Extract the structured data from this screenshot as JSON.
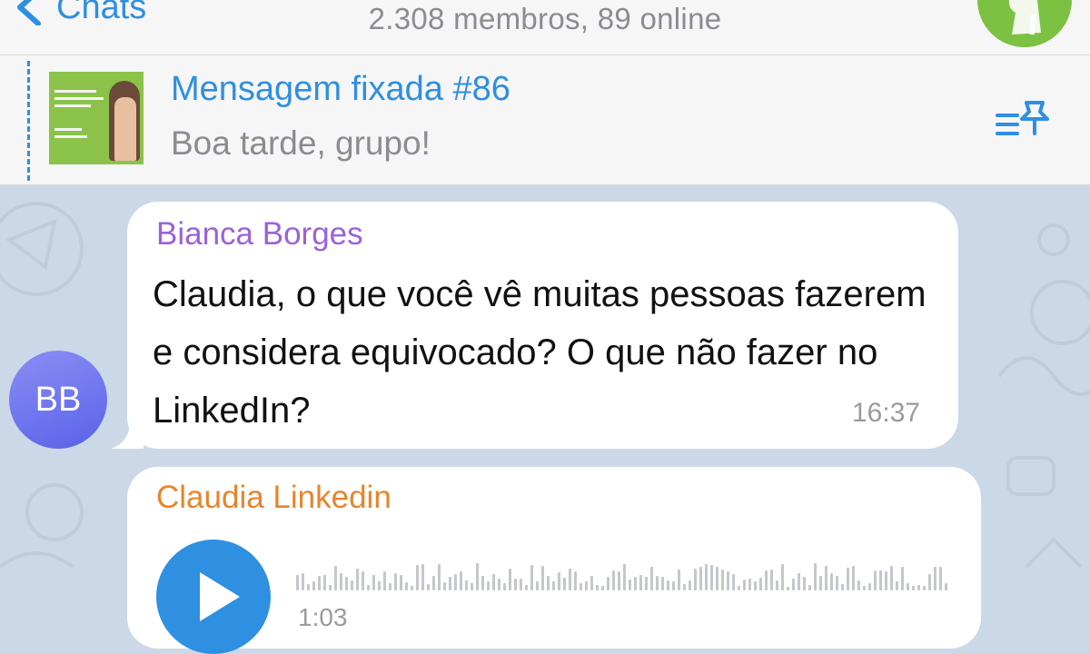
{
  "header": {
    "back_label": "Chats",
    "subtitle": "2.308 membros, 89 online"
  },
  "pinned": {
    "title": "Mensagem fixada #86",
    "text": "Boa tarde, grupo!"
  },
  "messages": [
    {
      "avatar_initials": "BB",
      "sender": "Bianca Borges",
      "text": "Claudia, o que você vê muitas pessoas fazerem e considera equivocado? O que não fazer no LinkedIn?",
      "time": "16:37"
    },
    {
      "sender": "Claudia Linkedin",
      "type": "voice",
      "duration": "1:03"
    }
  ],
  "colors": {
    "accent": "#2f8fe0",
    "sender1": "#9b62d8",
    "sender2": "#e6852e",
    "chat_background": "#cbd8e7"
  }
}
